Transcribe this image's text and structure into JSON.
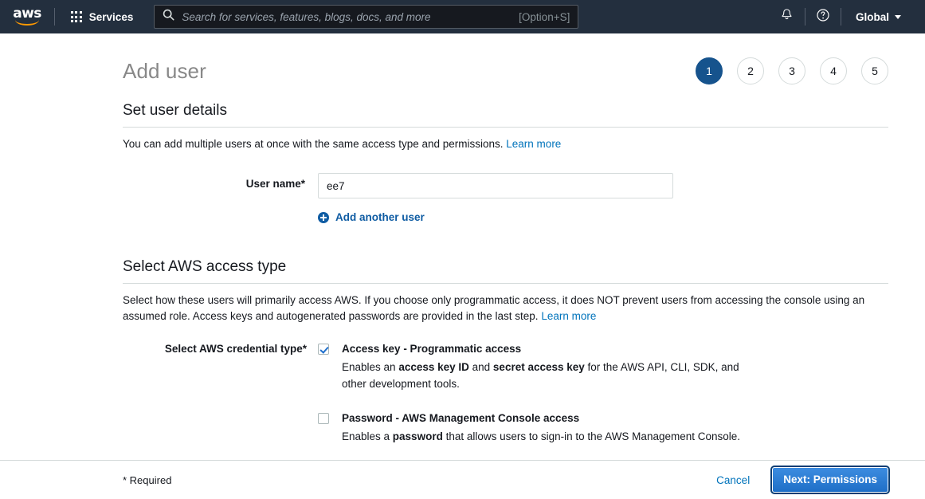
{
  "navbar": {
    "logo_text": "aws",
    "logo_icon": "aws-logo-icon",
    "services_label": "Services",
    "services_icon": "grid-menu-icon",
    "search": {
      "placeholder": "Search for services, features, blogs, docs, and more",
      "shortcut_hint": "[Option+S]",
      "icon": "search-icon"
    },
    "notifications_icon": "bell-icon",
    "help_icon": "help-circle-icon",
    "region_label": "Global",
    "region_caret_icon": "chevron-down-icon"
  },
  "header": {
    "page_title": "Add user",
    "steps": [
      {
        "number": "1",
        "active": true
      },
      {
        "number": "2",
        "active": false
      },
      {
        "number": "3",
        "active": false
      },
      {
        "number": "4",
        "active": false
      },
      {
        "number": "5",
        "active": false
      }
    ]
  },
  "user_details": {
    "heading": "Set user details",
    "description": "You can add multiple users at once with the same access type and permissions.",
    "learn_more": "Learn more",
    "username_label": "User name*",
    "username_value": "ee7",
    "add_another_label": "Add another user",
    "add_another_icon": "plus-circle-icon"
  },
  "access_type": {
    "heading": "Select AWS access type",
    "description": "Select how these users will primarily access AWS. If you choose only programmatic access, it does NOT prevent users from accessing the console using an assumed role. Access keys and autogenerated passwords are provided in the last step.",
    "learn_more": "Learn more",
    "credential_label": "Select AWS credential type*",
    "options": [
      {
        "title": "Access key - Programmatic access",
        "checked": true,
        "desc_1": "Enables an ",
        "desc_b1": "access key ID",
        "desc_2": " and ",
        "desc_b2": "secret access key",
        "desc_3": " for the AWS API, CLI, SDK, and other development tools."
      },
      {
        "title": "Password - AWS Management Console access",
        "checked": false,
        "desc_1": "Enables a ",
        "desc_b1": "password",
        "desc_2": " that allows users to sign-in to the AWS Management Console.",
        "desc_b2": "",
        "desc_3": ""
      }
    ]
  },
  "footer": {
    "required_note": "* Required",
    "cancel_label": "Cancel",
    "next_label": "Next: Permissions"
  },
  "colors": {
    "nav_bg": "#232f3e",
    "accent_orange": "#ff9900",
    "link_blue": "#0073bb",
    "step_active": "#16538d",
    "button_blue": "#1f6fc7"
  }
}
